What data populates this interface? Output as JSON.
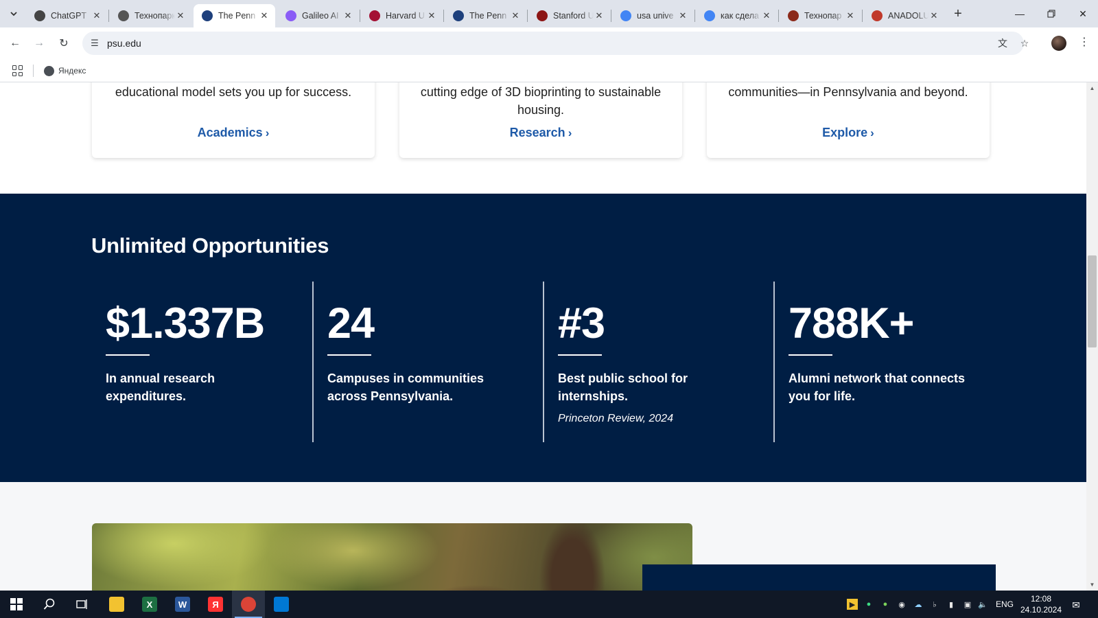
{
  "browser": {
    "tabs": [
      {
        "title": "ChatGPT",
        "favicon": "chatgpt-icon",
        "color": "#444444",
        "active": false
      },
      {
        "title": "Технопарк",
        "favicon": "globe-icon",
        "color": "#555555",
        "active": false
      },
      {
        "title": "The Penn",
        "favicon": "penn-state-shield-icon",
        "color": "#1e407c",
        "active": true
      },
      {
        "title": "Galileo AI",
        "favicon": "galileo-icon",
        "color": "#8a5cf6",
        "active": false
      },
      {
        "title": "Harvard U",
        "favicon": "harvard-shield-icon",
        "color": "#a41034",
        "active": false
      },
      {
        "title": "The Penn",
        "favicon": "penn-state-shield-icon",
        "color": "#1e407c",
        "active": false
      },
      {
        "title": "Stanford U",
        "favicon": "stanford-icon",
        "color": "#8c1515",
        "active": false
      },
      {
        "title": "usa unive",
        "favicon": "google-icon",
        "color": "#4285f4",
        "active": false
      },
      {
        "title": "как сдела",
        "favicon": "google-icon",
        "color": "#4285f4",
        "active": false
      },
      {
        "title": "Технопар",
        "favicon": "technopark-icon",
        "color": "#8b2a1a",
        "active": false
      },
      {
        "title": "ANADOLU",
        "favicon": "anadolu-icon",
        "color": "#c0392b",
        "active": false
      }
    ],
    "url": "psu.edu",
    "bookmarks": [
      {
        "label": "Яндекс",
        "icon": "globe-icon"
      }
    ]
  },
  "page": {
    "cards": [
      {
        "text": "educational model sets you up for success.",
        "link": "Academics"
      },
      {
        "text": "cutting edge of 3D bioprinting to sustainable housing.",
        "link": "Research"
      },
      {
        "text": "communities—in Pennsylvania and beyond.",
        "link": "Explore"
      }
    ],
    "stats_title": "Unlimited Opportunities",
    "stats": [
      {
        "value": "$1.337B",
        "label": "In annual research expenditures.",
        "source": ""
      },
      {
        "value": "24",
        "label": "Campuses in communities across Pennsylvania.",
        "source": ""
      },
      {
        "value": "#3",
        "label": "Best public school for internships.",
        "source": "Princeton Review, 2024"
      },
      {
        "value": "788K+",
        "label": "Alumni network that connects you for life.",
        "source": ""
      }
    ],
    "colors": {
      "navy": "#001e44",
      "link_blue": "#1e5aa8"
    }
  },
  "taskbar": {
    "apps": [
      {
        "name": "file-explorer-icon",
        "glyph": "",
        "color": "#f2c230"
      },
      {
        "name": "excel-icon",
        "glyph": "X",
        "color": "#1d6f42"
      },
      {
        "name": "word-icon",
        "glyph": "W",
        "color": "#2b579a"
      },
      {
        "name": "yandex-browser-icon",
        "glyph": "Я",
        "color": "#ff3333"
      },
      {
        "name": "chrome-icon",
        "glyph": "",
        "color": "#db4437"
      },
      {
        "name": "vscode-icon",
        "glyph": "",
        "color": "#0078d4"
      }
    ],
    "language": "ENG",
    "time": "12:08",
    "date": "24.10.2024"
  }
}
